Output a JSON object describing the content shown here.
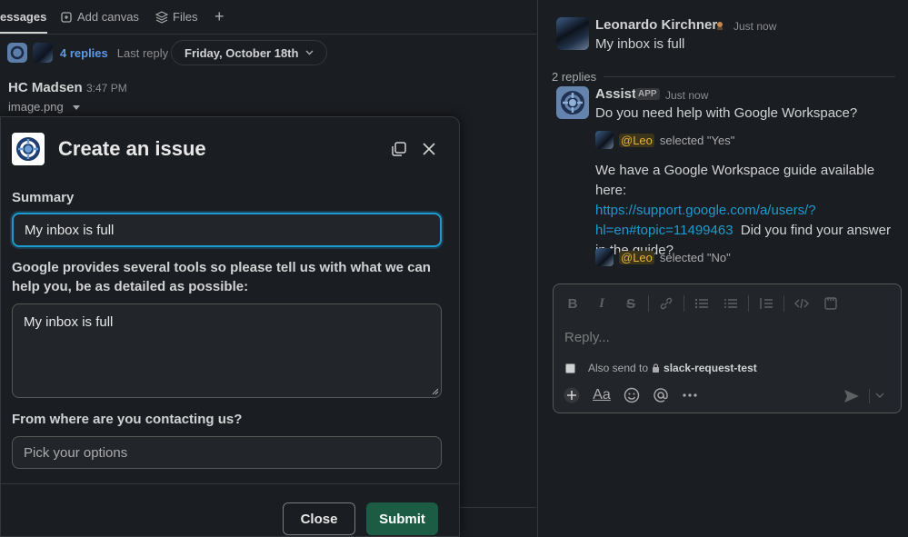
{
  "tabs": [
    {
      "label": "essages",
      "icon": "message-icon"
    },
    {
      "label": "Add canvas",
      "icon": "canvas-icon"
    },
    {
      "label": "Files",
      "icon": "files-icon"
    },
    {
      "label": "+",
      "icon": "plus-icon"
    }
  ],
  "thread_summary": {
    "replies": "4 replies",
    "last_reply": "Last reply 1",
    "date_pill": "Friday, October 18th"
  },
  "message": {
    "author": "HC Madsen",
    "time": "3:47 PM",
    "file": "image.png"
  },
  "modal": {
    "title": "Create an issue",
    "summary_label": "Summary",
    "summary_value": "My inbox is full",
    "details_label": "Google provides several tools so please tell us with what we can help you, be as detailed as possible:",
    "details_value": "My inbox is full",
    "contact_label": "From where are you contacting us?",
    "contact_placeholder": "Pick your options",
    "close_label": "Close",
    "submit_label": "Submit"
  },
  "thread": {
    "root": {
      "author": "Leonardo Kirchner",
      "time": "Just now",
      "text": "My inbox is full"
    },
    "replies_divider": "2 replies",
    "assist": {
      "author": "Assist",
      "badge": "APP",
      "time": "Just now",
      "question": "Do you need help with Google Workspace?",
      "selection1_mention": "@Leo",
      "selection1_text": "selected \"Yes\"",
      "guide_intro": "We have a Google Workspace guide available here:",
      "guide_link_line1": "https://support.google.com/a/users/?",
      "guide_link_line2": "hl=en#topic=11499463",
      "guide_after": "Did you find your answer",
      "guide_after2": "in the guide?",
      "selection2_mention": "@Leo",
      "selection2_text": "selected \"No\""
    },
    "composer": {
      "placeholder": "Reply...",
      "also_send_to": "Also send to",
      "channel": "slack-request-test"
    }
  },
  "colors": {
    "background": "#1a1d21",
    "accent_focus": "#1d9bd1",
    "submit": "#1d5c44",
    "link": "#1d9bd1",
    "mention": "#e2b33f"
  }
}
